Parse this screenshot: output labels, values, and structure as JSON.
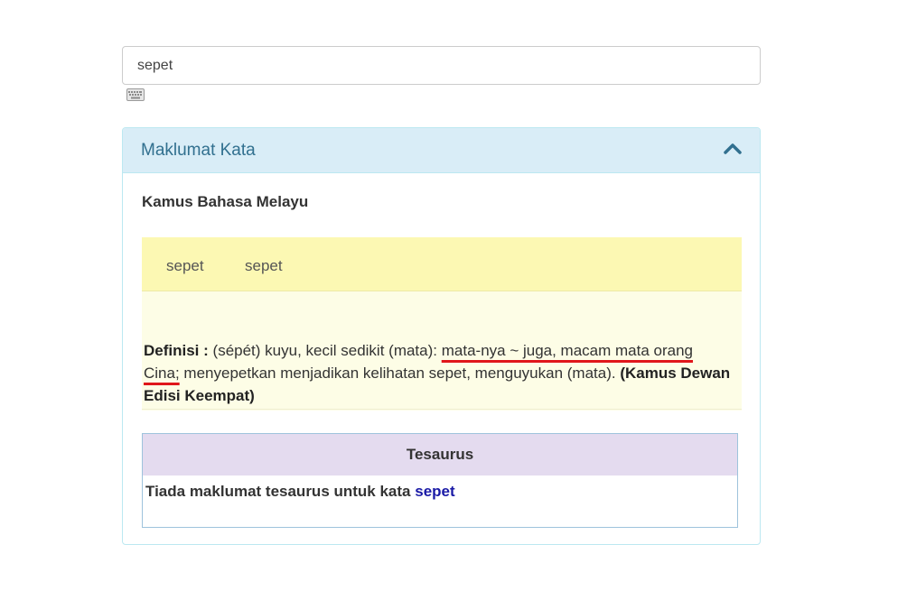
{
  "search": {
    "value": "sepet"
  },
  "icons": {
    "keyboard": "keyboard-icon",
    "collapse": "chevron-up-icon"
  },
  "colors": {
    "panel_heading_bg": "#d9edf7",
    "panel_title": "#31708f",
    "entry_head_bg": "#fcf8b3",
    "entry_body_bg": "#fdfde6",
    "tesaurus_head_bg": "#e4dbef",
    "link": "#1a1aa6",
    "annotation_underline": "#e0161b"
  },
  "panel": {
    "title": "Maklumat Kata",
    "dictionary_heading": "Kamus Bahasa Melayu",
    "entry": {
      "headwords": [
        "sepet",
        "sepet"
      ],
      "definition_label": "Definisi :",
      "definition_part1": "(sépét) kuyu, kecil sedikit (mata):",
      "definition_underlined": "mata-nya ~ juga, macam mata orang Cina;",
      "definition_part2": "menyepetkan menjadikan kelihatan sepet, menguyukan (mata).",
      "source": "(Kamus Dewan Edisi Keempat)"
    },
    "tesaurus": {
      "heading": "Tesaurus",
      "message": "Tiada maklumat tesaurus untuk kata",
      "link_word": "sepet"
    }
  }
}
